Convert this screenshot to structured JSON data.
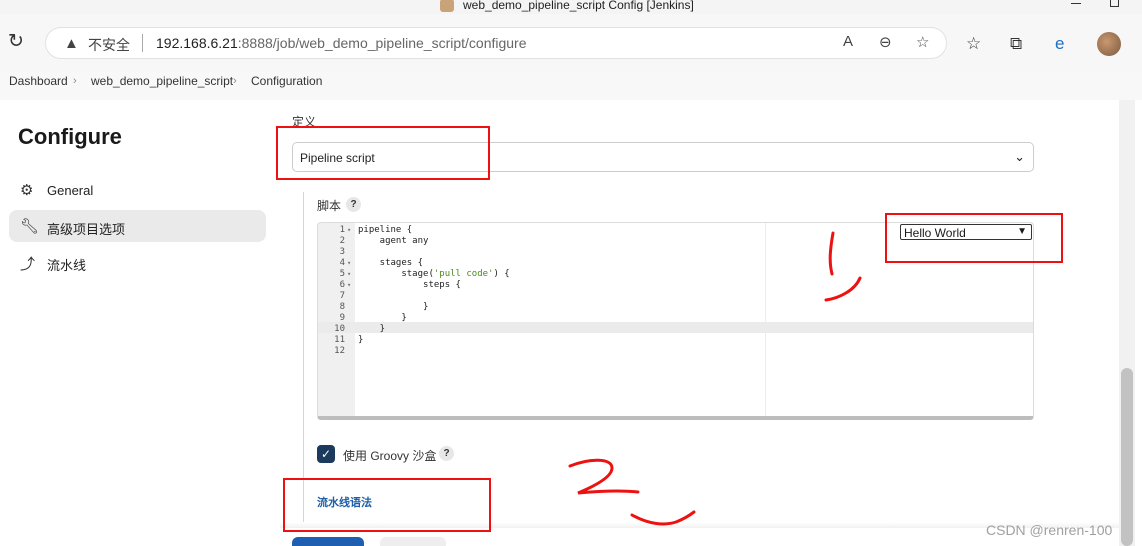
{
  "window": {
    "title": "web_demo_pipeline_script Config [Jenkins]"
  },
  "address_bar": {
    "security_label": "不安全",
    "url_host": "192.168.6.21",
    "url_rest": ":8888/job/web_demo_pipeline_script/configure"
  },
  "breadcrumb": [
    "Dashboard",
    "web_demo_pipeline_script",
    "Configuration"
  ],
  "sidebar": {
    "title": "Configure",
    "items": [
      {
        "label": "General",
        "icon": "gear-icon",
        "active": false
      },
      {
        "label": "高级项目选项",
        "icon": "wrench-icon",
        "active": true
      },
      {
        "label": "流水线",
        "icon": "pipeline-icon",
        "active": false
      }
    ]
  },
  "definition": {
    "label": "定义",
    "value": "Pipeline script"
  },
  "script": {
    "label": "脚本",
    "help": "?",
    "sample_select": "Hello World",
    "lines": [
      {
        "n": "1",
        "fold": true,
        "code": "pipeline {"
      },
      {
        "n": "2",
        "fold": false,
        "code": "    agent any"
      },
      {
        "n": "3",
        "fold": false,
        "code": ""
      },
      {
        "n": "4",
        "fold": true,
        "code": "    stages {"
      },
      {
        "n": "5",
        "fold": true,
        "code": "        stage('pull code') {"
      },
      {
        "n": "6",
        "fold": true,
        "code": "            steps {"
      },
      {
        "n": "7",
        "fold": false,
        "code": ""
      },
      {
        "n": "8",
        "fold": false,
        "code": "            }"
      },
      {
        "n": "9",
        "fold": false,
        "code": "        }"
      },
      {
        "n": "10",
        "fold": false,
        "code": "    }"
      },
      {
        "n": "11",
        "fold": false,
        "code": "}"
      },
      {
        "n": "12",
        "fold": false,
        "code": ""
      }
    ],
    "active_line": "10"
  },
  "sandbox": {
    "label": "使用 Groovy 沙盒",
    "checked": true,
    "help": "?"
  },
  "pipeline_syntax_link": "流水线语法",
  "watermark": "CSDN @renren-100",
  "colors": {
    "annotation": "#e11111",
    "checkbox": "#1b3a5c",
    "link": "#1f5fa8",
    "save_button": "#1f5fb2"
  }
}
